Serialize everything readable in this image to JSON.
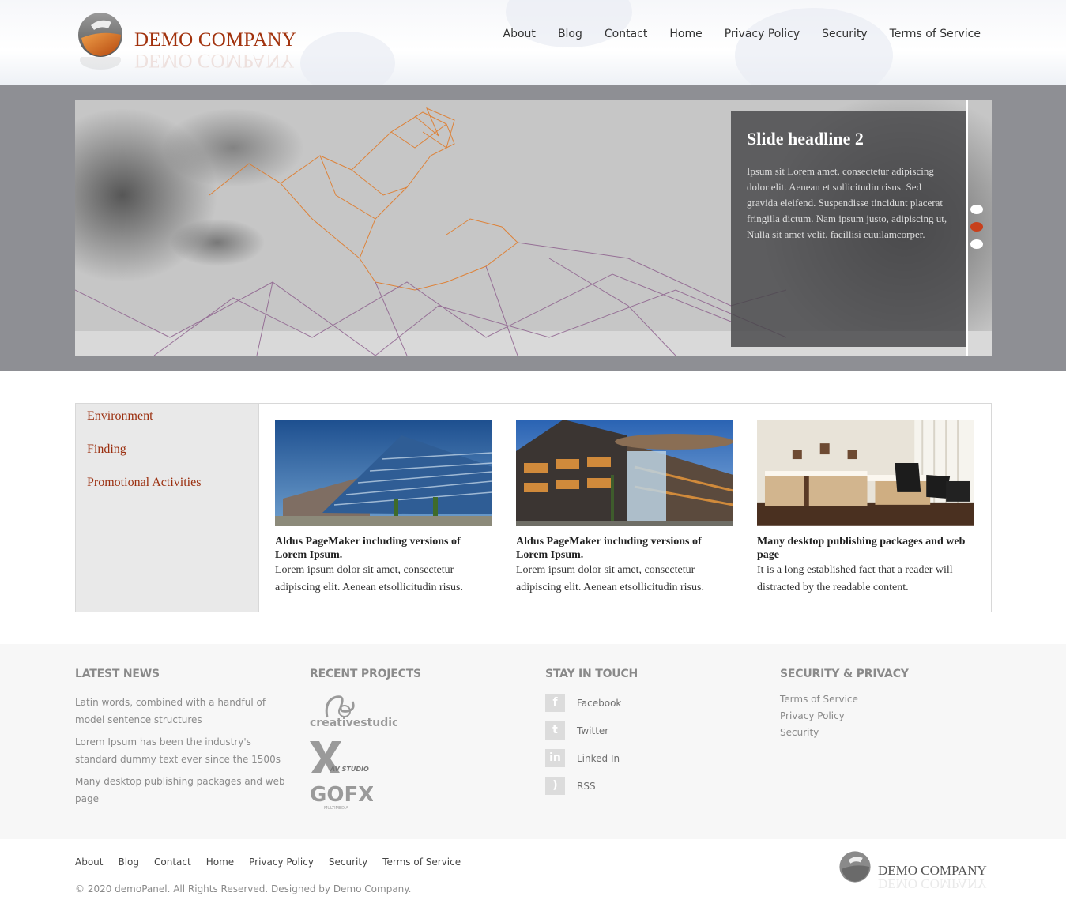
{
  "header": {
    "logo_text": "DEMO COMPANY",
    "nav": [
      "About",
      "Blog",
      "Contact",
      "Home",
      "Privacy Policy",
      "Security",
      "Terms of Service"
    ]
  },
  "slider": {
    "headline": "Slide headline 2",
    "text": "Ipsum  sit Lorem amet, consectetur adipiscing dolor elit. Aenean et sollicitudin risus. Sed gravida eleifend. Suspendisse tincidunt placerat fringilla dictum. Nam ipsum justo, adipiscing ut, Nulla sit amet velit. facillisi euuilamcorper.",
    "active_slide_index": 1,
    "slide_count": 3
  },
  "side_menu": [
    "Environment",
    "Finding",
    "Promotional Activities"
  ],
  "cards": [
    {
      "title": "Aldus PageMaker including versions of Lorem Ipsum.",
      "text": "Lorem ipsum dolor sit amet, consectetur adipiscing elit. Aenean etsollicitudin risus."
    },
    {
      "title": "Aldus PageMaker including versions of Lorem Ipsum.",
      "text": "Lorem ipsum dolor sit amet, consectetur adipiscing elit. Aenean etsollicitudin risus."
    },
    {
      "title": "Many desktop publishing packages and web page",
      "text": "It is a long established fact that a reader will distracted by the readable content."
    }
  ],
  "widgets": {
    "latest_news": {
      "heading": "LATEST NEWS",
      "items": [
        "Latin words, combined with a handful of model sentence structures",
        "Lorem Ipsum has been the industry's standard dummy text ever since the 1500s",
        "Many desktop publishing packages and web page"
      ]
    },
    "recent_projects": {
      "heading": "RECENT PROJECTS",
      "logos": [
        "creativestudio",
        "AV STUDIO",
        "GOFX",
        "MULTIMEDIA"
      ]
    },
    "stay_in_touch": {
      "heading": "STAY IN TOUCH",
      "items": [
        {
          "label": "Facebook",
          "icon": "facebook-icon",
          "glyph": "f"
        },
        {
          "label": "Twitter",
          "icon": "twitter-icon",
          "glyph": "t"
        },
        {
          "label": "Linked In",
          "icon": "linkedin-icon",
          "glyph": "in"
        },
        {
          "label": "RSS",
          "icon": "rss-icon",
          "glyph": ")"
        }
      ]
    },
    "security_privacy": {
      "heading": "SECURITY & PRIVACY",
      "links": [
        "Terms of Service",
        "Privacy Policy",
        "Security"
      ]
    }
  },
  "bottom": {
    "nav": [
      "About",
      "Blog",
      "Contact",
      "Home",
      "Privacy Policy",
      "Security",
      "Terms of Service"
    ],
    "copyright": "© 2020 demoPanel. All Rights Reserved. Designed by Demo Company.",
    "logo_text": "DEMO COMPANY"
  },
  "colors": {
    "brand": "#a1310c",
    "slider_band": "#8e8f94",
    "active_dot": "#c8401c",
    "footer_bg": "#f7f7f7"
  }
}
